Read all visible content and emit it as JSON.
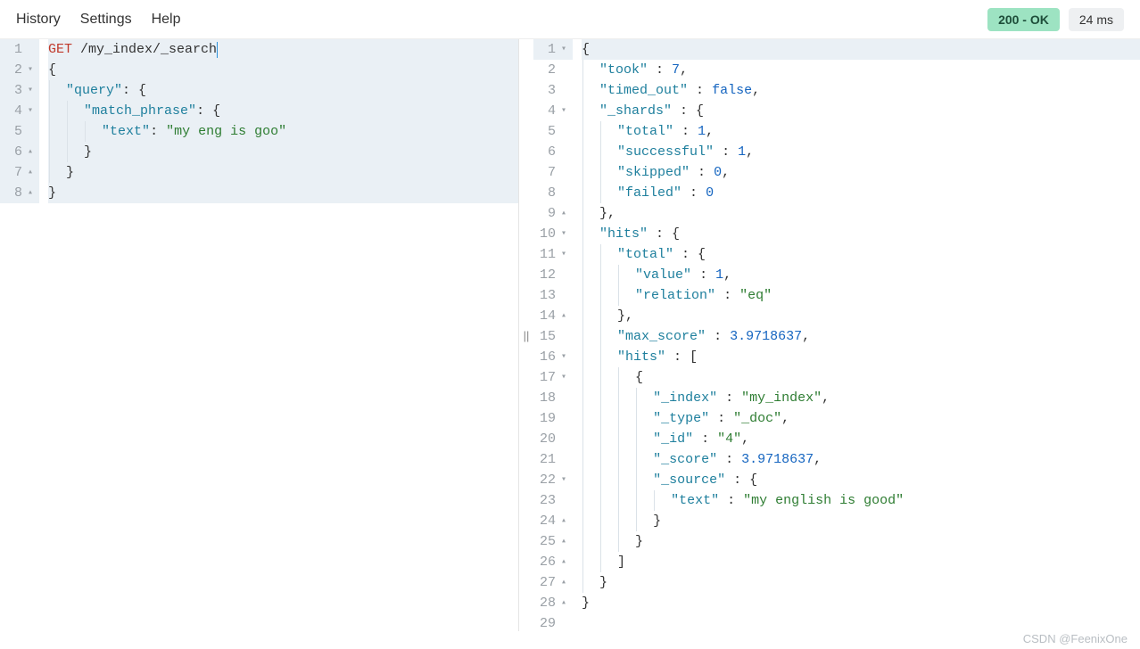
{
  "menu": {
    "history": "History",
    "settings": "Settings",
    "help": "Help"
  },
  "status": {
    "code": "200 - OK",
    "time": "24 ms"
  },
  "watermark": "CSDN @FeenixOne",
  "request": {
    "lines": [
      {
        "n": 1,
        "fold": "",
        "hl": true,
        "tokens": [
          {
            "t": "GET",
            "c": "method"
          },
          {
            "t": " ",
            "c": "plain"
          },
          {
            "t": "/my_index/_search",
            "c": "plain"
          },
          {
            "t": "|",
            "c": "cursor"
          }
        ]
      },
      {
        "n": 2,
        "fold": "▾",
        "hl": true,
        "indent": 0,
        "tokens": [
          {
            "t": "{",
            "c": "punc"
          }
        ]
      },
      {
        "n": 3,
        "fold": "▾",
        "hl": true,
        "indent": 1,
        "tokens": [
          {
            "t": "\"query\"",
            "c": "key"
          },
          {
            "t": ": {",
            "c": "punc"
          }
        ]
      },
      {
        "n": 4,
        "fold": "▾",
        "hl": true,
        "indent": 2,
        "tokens": [
          {
            "t": "\"match_phrase\"",
            "c": "key"
          },
          {
            "t": ": {",
            "c": "punc"
          }
        ]
      },
      {
        "n": 5,
        "fold": "",
        "hl": true,
        "indent": 3,
        "tokens": [
          {
            "t": "\"text\"",
            "c": "key"
          },
          {
            "t": ": ",
            "c": "punc"
          },
          {
            "t": "\"my eng is goo\"",
            "c": "str"
          }
        ]
      },
      {
        "n": 6,
        "fold": "▴",
        "hl": true,
        "indent": 2,
        "tokens": [
          {
            "t": "}",
            "c": "punc"
          }
        ]
      },
      {
        "n": 7,
        "fold": "▴",
        "hl": true,
        "indent": 1,
        "tokens": [
          {
            "t": "}",
            "c": "punc"
          }
        ]
      },
      {
        "n": 8,
        "fold": "▴",
        "hl": true,
        "indent": 0,
        "tokens": [
          {
            "t": "}",
            "c": "punc"
          }
        ]
      }
    ]
  },
  "response": {
    "lines": [
      {
        "n": 1,
        "fold": "▾",
        "hl": true,
        "indent": 0,
        "tokens": [
          {
            "t": "{",
            "c": "punc"
          }
        ]
      },
      {
        "n": 2,
        "fold": "",
        "indent": 1,
        "tokens": [
          {
            "t": "\"took\"",
            "c": "key"
          },
          {
            "t": " : ",
            "c": "punc"
          },
          {
            "t": "7",
            "c": "num"
          },
          {
            "t": ",",
            "c": "punc"
          }
        ]
      },
      {
        "n": 3,
        "fold": "",
        "indent": 1,
        "tokens": [
          {
            "t": "\"timed_out\"",
            "c": "key"
          },
          {
            "t": " : ",
            "c": "punc"
          },
          {
            "t": "false",
            "c": "bool"
          },
          {
            "t": ",",
            "c": "punc"
          }
        ]
      },
      {
        "n": 4,
        "fold": "▾",
        "indent": 1,
        "tokens": [
          {
            "t": "\"_shards\"",
            "c": "key"
          },
          {
            "t": " : {",
            "c": "punc"
          }
        ]
      },
      {
        "n": 5,
        "fold": "",
        "indent": 2,
        "tokens": [
          {
            "t": "\"total\"",
            "c": "key"
          },
          {
            "t": " : ",
            "c": "punc"
          },
          {
            "t": "1",
            "c": "num"
          },
          {
            "t": ",",
            "c": "punc"
          }
        ]
      },
      {
        "n": 6,
        "fold": "",
        "indent": 2,
        "tokens": [
          {
            "t": "\"successful\"",
            "c": "key"
          },
          {
            "t": " : ",
            "c": "punc"
          },
          {
            "t": "1",
            "c": "num"
          },
          {
            "t": ",",
            "c": "punc"
          }
        ]
      },
      {
        "n": 7,
        "fold": "",
        "indent": 2,
        "tokens": [
          {
            "t": "\"skipped\"",
            "c": "key"
          },
          {
            "t": " : ",
            "c": "punc"
          },
          {
            "t": "0",
            "c": "num"
          },
          {
            "t": ",",
            "c": "punc"
          }
        ]
      },
      {
        "n": 8,
        "fold": "",
        "indent": 2,
        "tokens": [
          {
            "t": "\"failed\"",
            "c": "key"
          },
          {
            "t": " : ",
            "c": "punc"
          },
          {
            "t": "0",
            "c": "num"
          }
        ]
      },
      {
        "n": 9,
        "fold": "▴",
        "indent": 1,
        "tokens": [
          {
            "t": "},",
            "c": "punc"
          }
        ]
      },
      {
        "n": 10,
        "fold": "▾",
        "indent": 1,
        "tokens": [
          {
            "t": "\"hits\"",
            "c": "key"
          },
          {
            "t": " : {",
            "c": "punc"
          }
        ]
      },
      {
        "n": 11,
        "fold": "▾",
        "indent": 2,
        "tokens": [
          {
            "t": "\"total\"",
            "c": "key"
          },
          {
            "t": " : {",
            "c": "punc"
          }
        ]
      },
      {
        "n": 12,
        "fold": "",
        "indent": 3,
        "tokens": [
          {
            "t": "\"value\"",
            "c": "key"
          },
          {
            "t": " : ",
            "c": "punc"
          },
          {
            "t": "1",
            "c": "num"
          },
          {
            "t": ",",
            "c": "punc"
          }
        ]
      },
      {
        "n": 13,
        "fold": "",
        "indent": 3,
        "tokens": [
          {
            "t": "\"relation\"",
            "c": "key"
          },
          {
            "t": " : ",
            "c": "punc"
          },
          {
            "t": "\"eq\"",
            "c": "str"
          }
        ]
      },
      {
        "n": 14,
        "fold": "▴",
        "indent": 2,
        "tokens": [
          {
            "t": "},",
            "c": "punc"
          }
        ]
      },
      {
        "n": 15,
        "fold": "",
        "indent": 2,
        "tokens": [
          {
            "t": "\"max_score\"",
            "c": "key"
          },
          {
            "t": " : ",
            "c": "punc"
          },
          {
            "t": "3.9718637",
            "c": "num"
          },
          {
            "t": ",",
            "c": "punc"
          }
        ]
      },
      {
        "n": 16,
        "fold": "▾",
        "indent": 2,
        "tokens": [
          {
            "t": "\"hits\"",
            "c": "key"
          },
          {
            "t": " : [",
            "c": "punc"
          }
        ]
      },
      {
        "n": 17,
        "fold": "▾",
        "indent": 3,
        "tokens": [
          {
            "t": "{",
            "c": "punc"
          }
        ]
      },
      {
        "n": 18,
        "fold": "",
        "indent": 4,
        "tokens": [
          {
            "t": "\"_index\"",
            "c": "key"
          },
          {
            "t": " : ",
            "c": "punc"
          },
          {
            "t": "\"my_index\"",
            "c": "str"
          },
          {
            "t": ",",
            "c": "punc"
          }
        ]
      },
      {
        "n": 19,
        "fold": "",
        "indent": 4,
        "tokens": [
          {
            "t": "\"_type\"",
            "c": "key"
          },
          {
            "t": " : ",
            "c": "punc"
          },
          {
            "t": "\"_doc\"",
            "c": "str"
          },
          {
            "t": ",",
            "c": "punc"
          }
        ]
      },
      {
        "n": 20,
        "fold": "",
        "indent": 4,
        "tokens": [
          {
            "t": "\"_id\"",
            "c": "key"
          },
          {
            "t": " : ",
            "c": "punc"
          },
          {
            "t": "\"4\"",
            "c": "str"
          },
          {
            "t": ",",
            "c": "punc"
          }
        ]
      },
      {
        "n": 21,
        "fold": "",
        "indent": 4,
        "tokens": [
          {
            "t": "\"_score\"",
            "c": "key"
          },
          {
            "t": " : ",
            "c": "punc"
          },
          {
            "t": "3.9718637",
            "c": "num"
          },
          {
            "t": ",",
            "c": "punc"
          }
        ]
      },
      {
        "n": 22,
        "fold": "▾",
        "indent": 4,
        "tokens": [
          {
            "t": "\"_source\"",
            "c": "key"
          },
          {
            "t": " : {",
            "c": "punc"
          }
        ]
      },
      {
        "n": 23,
        "fold": "",
        "indent": 5,
        "tokens": [
          {
            "t": "\"text\"",
            "c": "key"
          },
          {
            "t": " : ",
            "c": "punc"
          },
          {
            "t": "\"my english is good\"",
            "c": "str"
          }
        ]
      },
      {
        "n": 24,
        "fold": "▴",
        "indent": 4,
        "tokens": [
          {
            "t": "}",
            "c": "punc"
          }
        ]
      },
      {
        "n": 25,
        "fold": "▴",
        "indent": 3,
        "tokens": [
          {
            "t": "}",
            "c": "punc"
          }
        ]
      },
      {
        "n": 26,
        "fold": "▴",
        "indent": 2,
        "tokens": [
          {
            "t": "]",
            "c": "punc"
          }
        ]
      },
      {
        "n": 27,
        "fold": "▴",
        "indent": 1,
        "tokens": [
          {
            "t": "}",
            "c": "punc"
          }
        ]
      },
      {
        "n": 28,
        "fold": "▴",
        "indent": 0,
        "tokens": [
          {
            "t": "}",
            "c": "punc"
          }
        ]
      },
      {
        "n": 29,
        "fold": "",
        "indent": 0,
        "tokens": []
      }
    ]
  }
}
